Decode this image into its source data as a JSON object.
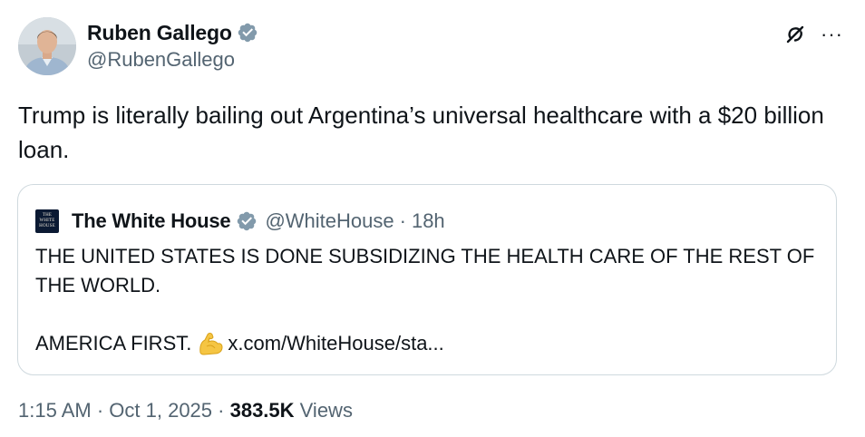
{
  "author": {
    "name": "Ruben Gallego",
    "handle": "@RubenGallego",
    "verified_color": "#829aab"
  },
  "tweet": {
    "text": "Trump is literally bailing out Argentina’s universal healthcare with a $20 billion loan."
  },
  "quote": {
    "avatar_lines": [
      "THE",
      "WHITE",
      "HOUSE"
    ],
    "name": "The White House",
    "handle": "@WhiteHouse",
    "separator": "·",
    "age": "18h",
    "line1": "THE UNITED STATES IS DONE SUBSIDIZING THE HEALTH CARE OF THE REST OF THE WORLD.",
    "line2_text": "AMERICA FIRST.",
    "emoji": "flexed-biceps",
    "link": "x.com/WhiteHouse/sta..."
  },
  "footer": {
    "time": "1:15 AM",
    "sep1": " · ",
    "date": "Oct 1, 2025",
    "sep2": " · ",
    "views_count": "383.5K",
    "views_label": " Views"
  },
  "icons": {
    "grok": "grok-icon",
    "more": "more-icon",
    "verified": "verified-badge-icon"
  },
  "colors": {
    "text": "#0f1419",
    "secondary": "#536471",
    "border": "#cfd9de",
    "verified_gray": "#829aab"
  }
}
